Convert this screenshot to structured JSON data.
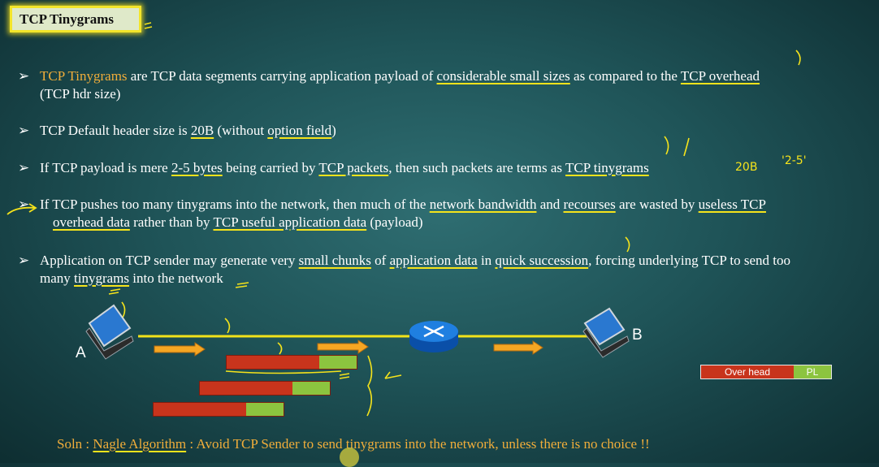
{
  "title": "TCP Tinygrams",
  "bullets": {
    "b1": {
      "p1": "TCP Tinygrams",
      "p2": " are TCP data segments carrying application payload of ",
      "p3": "considerable small sizes",
      "p4": " as compared to the ",
      "p5": "TCP overhead",
      "line2": "(TCP hdr size)"
    },
    "b2": {
      "p1": "TCP Default header size is ",
      "p2": "20B",
      "p3": " (without ",
      "p4": "option field",
      "p5": ")"
    },
    "b3": {
      "p1": "If TCP payload is mere ",
      "p2": "2-5 bytes",
      "p3": " being carried by ",
      "p4": "TCP packets",
      "p5": ", then such packets are terms as ",
      "p6": "TCP tinygrams"
    },
    "b4": {
      "p1": "If TCP pushes too many tinygrams into the network, then much of the ",
      "p2": "network bandwidth",
      "p3": " and ",
      "p4": "recourses",
      "p5": " are wasted by ",
      "p6": "useless TCP",
      "l2a": "overhead data",
      "l2b": " rather than by ",
      "l2c": "TCP useful application data",
      "l2d": " (payload)"
    },
    "b5": {
      "p1": "Application on TCP sender may generate very ",
      "p2": "small chunks",
      "p3": " of ",
      "p4": "application data",
      "p5": " in ",
      "p6": "quick succession",
      "p7": ", forcing underlying TCP  to send too",
      "l2a": "many ",
      "l2b": "tinygrams",
      "l2c": " into the network"
    }
  },
  "diagram": {
    "node_a": "A",
    "node_b": "B",
    "legend_overhead": "Over head",
    "legend_payload": "PL"
  },
  "handwritten": {
    "size_note": "20B",
    "range_note": "'2-5'"
  },
  "solution": {
    "prefix": "Soln : ",
    "name": "Nagle Algorithm",
    "rest": " : Avoid TCP Sender to send tinygrams into the network, unless there is no choice !!"
  }
}
